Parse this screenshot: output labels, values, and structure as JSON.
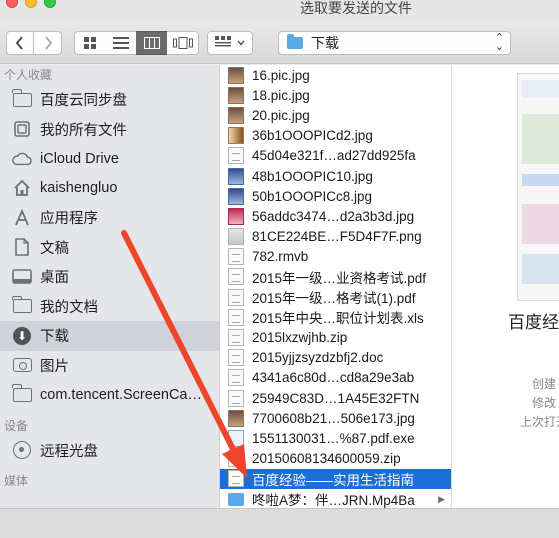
{
  "window": {
    "title": "选取要发送的文件",
    "traffic_lights": [
      "close",
      "minimize",
      "zoom"
    ]
  },
  "toolbar": {
    "back_icon": "chevron-left-icon",
    "forward_icon": "chevron-right-icon",
    "view_modes": [
      "icon-view",
      "list-view",
      "column-view",
      "cover-flow-view"
    ],
    "selected_view": "column-view",
    "arrange_icon": "arrange-grid-icon",
    "location": "下载"
  },
  "sidebar": {
    "favorites_header": "个人收藏",
    "favorites": [
      {
        "label": "百度云同步盘",
        "icon": "folder-icon"
      },
      {
        "label": "我的所有文件",
        "icon": "all-files-icon"
      },
      {
        "label": "iCloud Drive",
        "icon": "cloud-icon"
      },
      {
        "label": "kaishengluo",
        "icon": "home-icon"
      },
      {
        "label": "应用程序",
        "icon": "applications-icon"
      },
      {
        "label": "文稿",
        "icon": "documents-icon"
      },
      {
        "label": "桌面",
        "icon": "desktop-icon"
      },
      {
        "label": "我的文档",
        "icon": "folder-icon"
      },
      {
        "label": "下载",
        "icon": "download-icon",
        "selected": true
      },
      {
        "label": "图片",
        "icon": "camera-icon"
      },
      {
        "label": "com.tencent.ScreenCapture",
        "icon": "folder-icon"
      }
    ],
    "devices_header": "设备",
    "devices": [
      {
        "label": "远程光盘",
        "icon": "disc-icon"
      }
    ],
    "shared_header": "媒体"
  },
  "files": [
    {
      "name": "16.pic.jpg",
      "kind": "img"
    },
    {
      "name": "18.pic.jpg",
      "kind": "img"
    },
    {
      "name": "20.pic.jpg",
      "kind": "img"
    },
    {
      "name": "36b1OOOPICd2.jpg",
      "kind": "img2"
    },
    {
      "name": "45d04e321f…ad27dd925fa",
      "kind": "doc"
    },
    {
      "name": "48b1OOOPIC10.jpg",
      "kind": "img3"
    },
    {
      "name": "50b1OOOPICc8.jpg",
      "kind": "img3"
    },
    {
      "name": "56addc3474…d2a3b3d.jpg",
      "kind": "img4"
    },
    {
      "name": "81CE224BE…F5D4F7F.png",
      "kind": "png"
    },
    {
      "name": "782.rmvb",
      "kind": "doc"
    },
    {
      "name": "2015年一级…业资格考试.pdf",
      "kind": "doc"
    },
    {
      "name": "2015年一级…格考试(1).pdf",
      "kind": "doc"
    },
    {
      "name": "2015年中央…职位计划表.xls",
      "kind": "doc"
    },
    {
      "name": "2015lxzwjhb.zip",
      "kind": "doc"
    },
    {
      "name": "2015yjjzsyzdzbfj2.doc",
      "kind": "doc"
    },
    {
      "name": "4341a6c80d…cd8a29e3ab",
      "kind": "doc"
    },
    {
      "name": "25949C83D…1A45E32FTN",
      "kind": "doc"
    },
    {
      "name": "7700608b21…506e173.jpg",
      "kind": "img"
    },
    {
      "name": "1551130031…%87.pdf.exe",
      "kind": "exe"
    },
    {
      "name": "20150608134600059.zip",
      "kind": "doc"
    },
    {
      "name": "百度经验——实用生活指南",
      "kind": "doc",
      "selected": true
    },
    {
      "name": "咚啦A梦：伴…JRN.Mp4Ba",
      "kind": "folder",
      "has_children": true
    }
  ],
  "preview": {
    "title": "百度经验",
    "meta": [
      "创建",
      "修改",
      "上次打开"
    ]
  },
  "colors": {
    "selection": "#1b6fd6",
    "annotation_arrow": "#f0452a",
    "sidebar_bg": "#e4e6ea"
  }
}
